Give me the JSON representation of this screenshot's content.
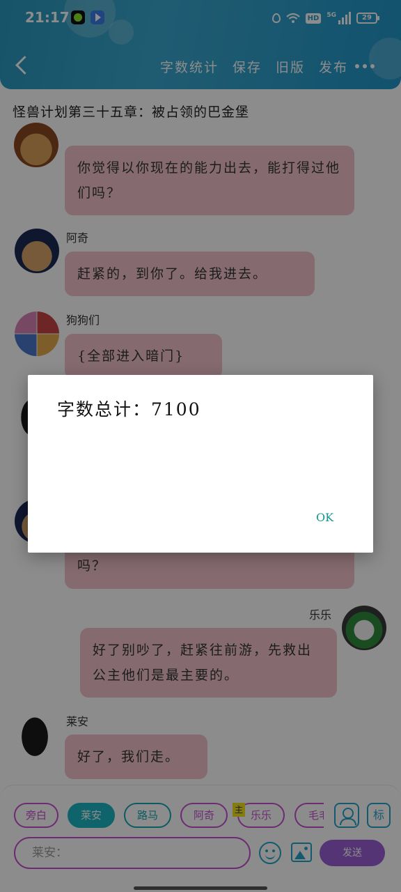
{
  "status_bar": {
    "time": "21:17",
    "network": "5G",
    "hd": "HD",
    "battery": "29"
  },
  "header": {
    "actions": [
      "字数统计",
      "保存",
      "旧版",
      "发布"
    ]
  },
  "chapter_title": "怪兽计划第三十五章：被占领的巴金堡",
  "messages": [
    {
      "sender": "",
      "text": "你觉得以你现在的能力出去，能打得过他们吗？",
      "side": "left"
    },
    {
      "sender": "阿奇",
      "text": "赶紧的，到你了。给我进去。",
      "side": "left"
    },
    {
      "sender": "狗狗们",
      "text": "{全部进入暗门}",
      "side": "left"
    },
    {
      "sender": "",
      "text": "吗？",
      "side": "left"
    },
    {
      "sender": "乐乐",
      "text": "好了别吵了，赶紧往前游，先救出公主他们是最主要的。",
      "side": "right"
    },
    {
      "sender": "莱安",
      "text": "好了，我们走。",
      "side": "left"
    }
  ],
  "character_chips": [
    {
      "label": "旁白",
      "state": "normal"
    },
    {
      "label": "莱安",
      "state": "selected"
    },
    {
      "label": "路马",
      "state": "teal"
    },
    {
      "label": "阿奇",
      "state": "normal"
    },
    {
      "label": "乐乐",
      "state": "normal"
    },
    {
      "label": "毛毛",
      "state": "normal"
    }
  ],
  "main_tag": "主",
  "tag_icon_label": "标",
  "input": {
    "value": "莱安："
  },
  "send_label": "发送",
  "dialog": {
    "message": "字数总计：7100",
    "ok_label": "OK"
  },
  "colors": {
    "accent": "#2a98bf",
    "bubble": "#f3c4cc",
    "chip": "#c54fd0",
    "send": "#9a5fd4",
    "ok": "#12988e"
  }
}
